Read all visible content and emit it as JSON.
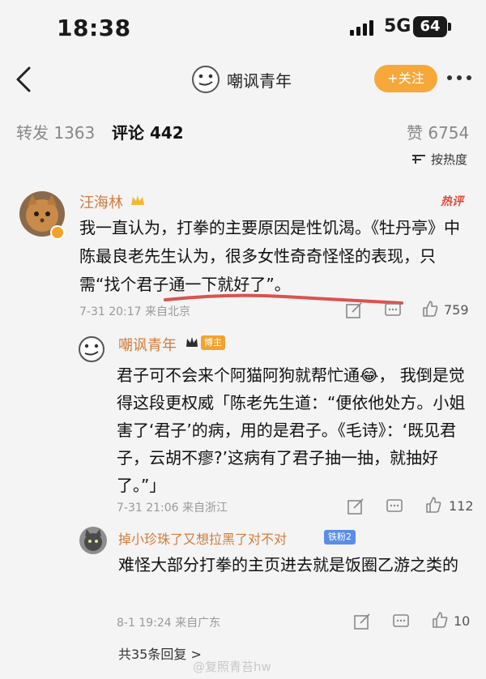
{
  "status": {
    "time": "18:38",
    "network": "5G",
    "battery": "64"
  },
  "nav": {
    "title": "嘲讽青年",
    "follow_label": "+关注"
  },
  "tabs": {
    "repost": "转发 1363",
    "comment": "评论 442",
    "like": "赞 6754"
  },
  "sort_label": "按热度",
  "comment_main": {
    "author": "汪海林",
    "hot_label": "热评",
    "text": "我一直认为，打拳的主要原因是性饥渴。《牡丹亭》中陈最良老先生认为，很多女性奇奇怪怪的表现，只需“找个君子通一下就好了”。",
    "meta": "7-31 20:17 来自北京",
    "likes": "759"
  },
  "reply_1": {
    "author": "嘲讽青年",
    "tag": "博主",
    "text": "君子可不会来个阿猫阿狗就帮忙通😂， 我倒是觉得这段更权威「陈老先生道：“便依他处方。小姐害了‘君子’的病，用的是君子。《毛诗》：‘既见君子，云胡不瘳?’这病有了君子抽一抽，就抽好了。”」",
    "meta": "7-31 21:06 来自浙江",
    "likes": "112"
  },
  "reply_2": {
    "author": "掉小珍珠了又想拉黑了对不对",
    "tag": "铁粉2",
    "text": "难怪大部分打拳的主页进去就是饭圈乙游之类的",
    "meta": "8-1 19:24 来自广东",
    "likes": "10"
  },
  "total_replies": "共35条回复 >",
  "watermark": "@复照青苔hw",
  "colors": {
    "accent": "#f7a83a",
    "name": "#d27b3b",
    "hot": "#e24b3a",
    "underline": "#d9534f"
  }
}
